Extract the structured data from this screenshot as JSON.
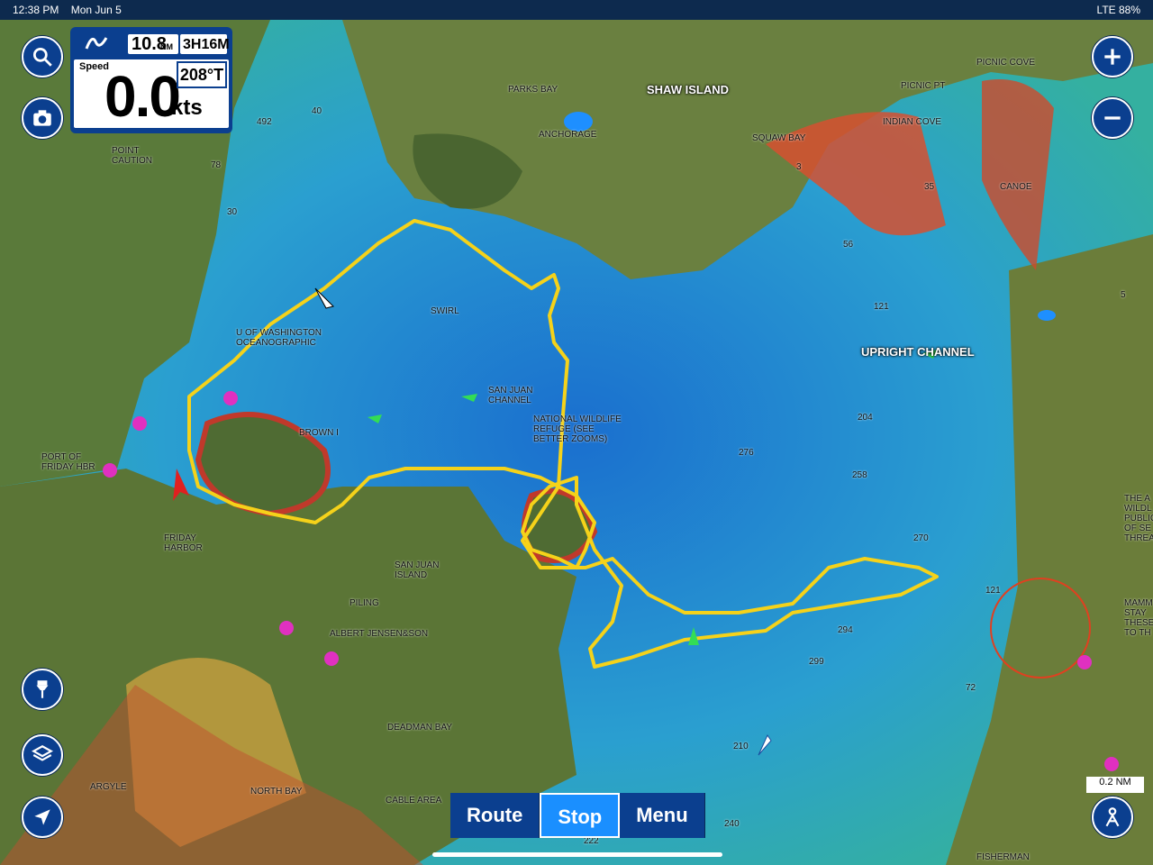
{
  "status_bar": {
    "time": "12:38 PM",
    "date": "Mon Jun 5",
    "right": "LTE 88%"
  },
  "info_panel": {
    "distance_value": "10.8",
    "distance_unit": "NM",
    "time_value": "3H16M",
    "speed_label": "Speed",
    "speed_value": "0.0",
    "speed_unit": "kts",
    "heading_value": "208°T"
  },
  "bottom_bar": {
    "route_label": "Route",
    "stop_label": "Stop",
    "menu_label": "Menu"
  },
  "map_labels": {
    "shaw_island": "SHAW ISLAND",
    "picnic_cove": "PICNIC COVE",
    "picnic_pt": "PICNIC PT",
    "parks_bay": "PARKS BAY",
    "anchorage": "ANCHORAGE",
    "squaw_bay": "SQUAW BAY",
    "indian_cove": "INDIAN COVE",
    "canoe": "CANOE",
    "point_caution": "POINT CAUTION",
    "u_of_washington": "U OF WASHINGTON OCEANOGRAPHIC",
    "swirl": "SWIRL",
    "upright_channel": "UPRIGHT CHANNEL",
    "san_juan_channel": "SAN JUAN CHANNEL",
    "national_wildlife": "NATIONAL WILDLIFE REFUGE (SEE BETTER ZOOMS)",
    "brown_i": "BROWN I",
    "port_of_friday": "PORT OF FRIDAY HBR",
    "friday_harbor": "FRIDAY HARBOR",
    "san_juan_island": "SAN JUAN ISLAND",
    "piling": "PILING",
    "albert_jensen": "ALBERT JENSEN&SON",
    "deadman_bay": "DEADMAN BAY",
    "argyle": "ARGYLE",
    "north_bay": "NORTH BAY",
    "cable_area": "CABLE AREA",
    "fisherman": "FISHERMAN",
    "the_a": "THE A WILDL PUBLIC OF SE THREA",
    "mamm": "MAMM STAY THESE TO TH"
  },
  "depth_labels": [
    "492",
    "40",
    "78",
    "30",
    "35",
    "56",
    "121",
    "204",
    "276",
    "258",
    "270",
    "294",
    "299",
    "210",
    "240",
    "222",
    "121",
    "5",
    "72",
    "3"
  ],
  "scale": "0.2 NM",
  "colors": {
    "panel": "#0b3f8f",
    "track": "#f5d21a",
    "accent": "#1a8fff"
  },
  "icons": {
    "search": "search-icon",
    "camera": "camera-icon",
    "zoom_in": "plus-icon",
    "zoom_out": "minus-icon",
    "pin": "pin-icon",
    "layers": "layers-icon",
    "navigate": "navigate-arrow-icon",
    "person": "person-icon",
    "boat": "boat-icon"
  }
}
